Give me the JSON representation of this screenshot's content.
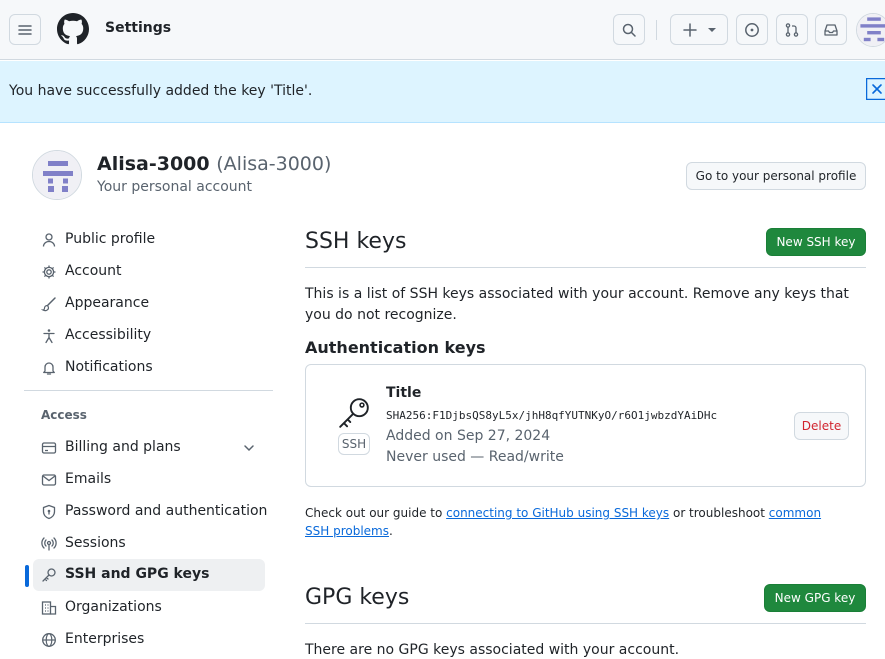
{
  "header": {
    "title": "Settings",
    "icons": [
      "hamburger-icon",
      "github-logo-icon",
      "search-icon",
      "plus-icon",
      "triangle-down-icon",
      "issue-icon",
      "pull-request-icon",
      "inbox-icon"
    ]
  },
  "flash": {
    "message": "You have successfully added the key 'Title'."
  },
  "profile": {
    "name": "Alisa-3000",
    "login": "(Alisa-3000)",
    "subtitle": "Your personal account",
    "profile_button": "Go to your personal profile"
  },
  "sidebar": {
    "items": [
      {
        "label": "Public profile",
        "icon": "person-icon"
      },
      {
        "label": "Account",
        "icon": "gear-icon"
      },
      {
        "label": "Appearance",
        "icon": "paintbrush-icon"
      },
      {
        "label": "Accessibility",
        "icon": "accessibility-icon"
      },
      {
        "label": "Notifications",
        "icon": "bell-icon"
      }
    ],
    "access_heading": "Access",
    "access_items": [
      {
        "label": "Billing and plans",
        "icon": "credit-card-icon"
      },
      {
        "label": "Emails",
        "icon": "mail-icon"
      },
      {
        "label": "Password and authentication",
        "icon": "shield-lock-icon"
      },
      {
        "label": "Sessions",
        "icon": "broadcast-icon"
      },
      {
        "label": "SSH and GPG keys",
        "icon": "key-icon",
        "active": true
      },
      {
        "label": "Organizations",
        "icon": "organization-icon"
      },
      {
        "label": "Enterprises",
        "icon": "globe-icon"
      }
    ]
  },
  "ssh": {
    "heading": "SSH keys",
    "new_button": "New SSH key",
    "description": "This is a list of SSH keys associated with your account. Remove any keys that you do not recognize.",
    "auth_heading": "Authentication keys",
    "key": {
      "title": "Title",
      "badge": "SSH",
      "fingerprint": "SHA256:F1DjbsQS8yL5x/jhH8qfYUTNKyO/r6O1jwbzdYAiDHc",
      "added": "Added on Sep 27, 2024",
      "usage": "Never used — Read/write",
      "delete_label": "Delete"
    },
    "guide_prefix": "Check out our guide to ",
    "guide_link": "connecting to GitHub using SSH keys",
    "guide_middle": " or troubleshoot ",
    "guide_link2": "common SSH problems",
    "guide_suffix": "."
  },
  "gpg": {
    "heading": "GPG keys",
    "new_button": "New GPG key",
    "empty": "There are no GPG keys associated with your account."
  },
  "colors": {
    "accent": "#0969da",
    "primary_button": "#1f883d",
    "danger": "#d1242f",
    "flash_bg": "#ddf4ff"
  }
}
